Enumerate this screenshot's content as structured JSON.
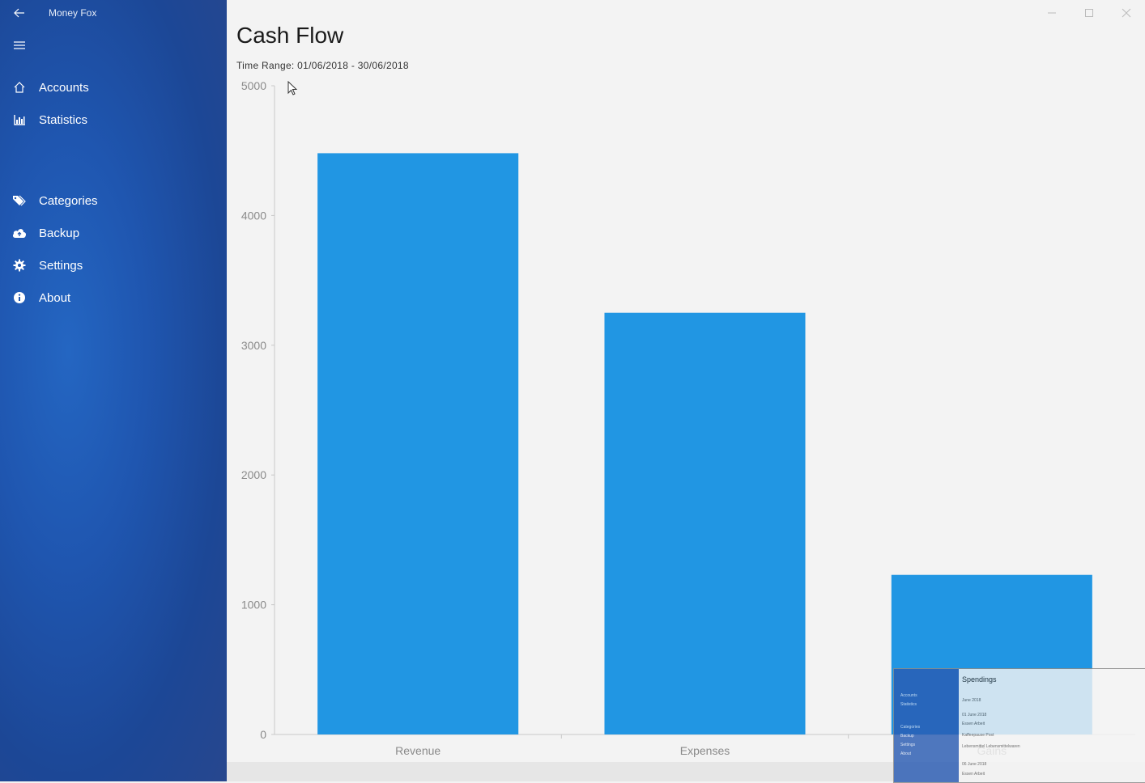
{
  "app": {
    "title": "Money Fox"
  },
  "sidebar": {
    "items": [
      {
        "label": "Accounts",
        "icon": "home-icon"
      },
      {
        "label": "Statistics",
        "icon": "bar-chart-icon"
      },
      {
        "label": "Categories",
        "icon": "tags-icon"
      },
      {
        "label": "Backup",
        "icon": "cloud-upload-icon"
      },
      {
        "label": "Settings",
        "icon": "gear-icon"
      },
      {
        "label": "About",
        "icon": "info-icon"
      }
    ]
  },
  "page": {
    "title": "Cash Flow",
    "time_range": "Time Range: 01/06/2018 - 30/06/2018"
  },
  "colors": {
    "accent": "#2196e3",
    "sidebar": "#1f56b0"
  },
  "chart_data": {
    "type": "bar",
    "categories": [
      "Revenue",
      "Expenses",
      "Gains"
    ],
    "values": [
      4480,
      3250,
      1230
    ],
    "ylim": [
      0,
      5000
    ],
    "yticks": [
      0,
      1000,
      2000,
      3000,
      4000,
      5000
    ],
    "grid": false,
    "legend": "none"
  },
  "thumbnail": {
    "title": "Spendings",
    "subtitle": "June 2018",
    "nav": [
      "Accounts",
      "Statistics",
      "Categories",
      "Backup",
      "Settings",
      "About"
    ],
    "rows": [
      "01 June 2018",
      "Essen Arbeit",
      "Kaffeepause Post",
      "Lebensmittel Lebensmittelwaren",
      "06 June 2018",
      "Essen Arbeit"
    ]
  }
}
